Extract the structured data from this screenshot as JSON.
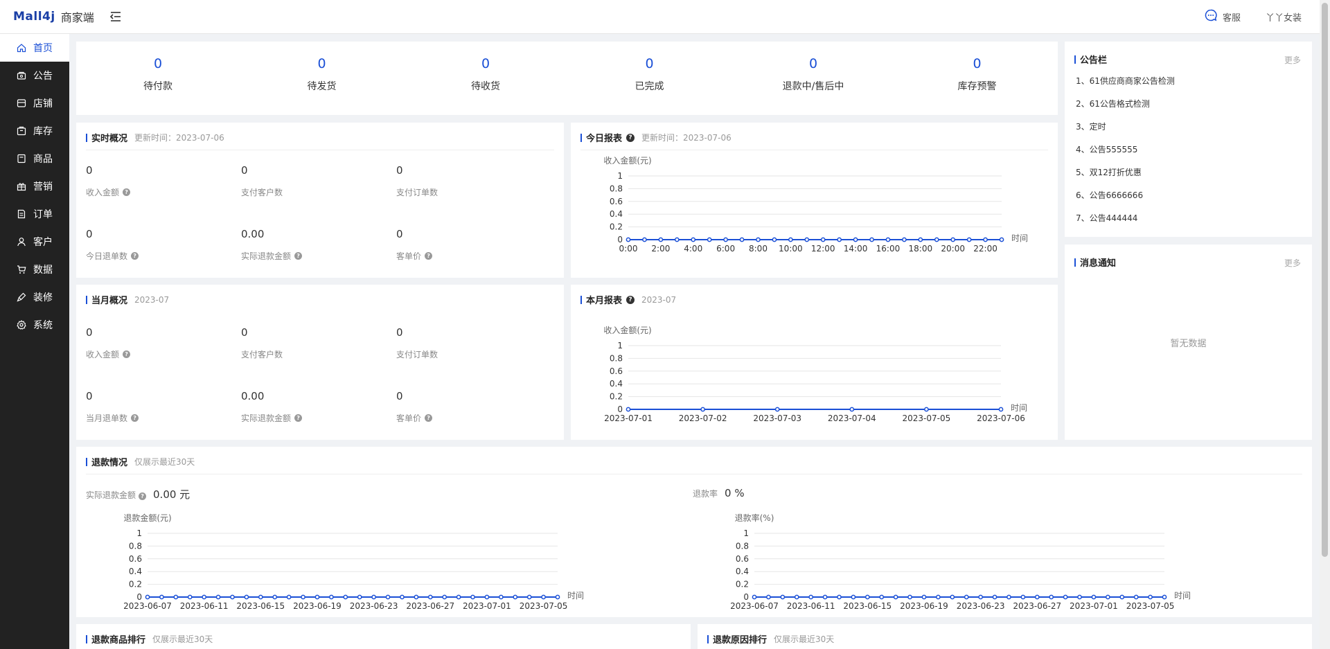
{
  "header": {
    "logo": "Mall4j",
    "logo_sub": "商家端",
    "customer_service": "客服",
    "user_name": "丫丫女装"
  },
  "sidebar": {
    "items": [
      {
        "label": "首页",
        "icon": "home-icon",
        "active": true
      },
      {
        "label": "公告",
        "icon": "announcement-icon"
      },
      {
        "label": "店铺",
        "icon": "store-icon"
      },
      {
        "label": "库存",
        "icon": "inventory-icon"
      },
      {
        "label": "商品",
        "icon": "product-icon"
      },
      {
        "label": "营销",
        "icon": "gift-icon"
      },
      {
        "label": "订单",
        "icon": "order-icon"
      },
      {
        "label": "客户",
        "icon": "user-icon"
      },
      {
        "label": "数据",
        "icon": "cart-icon"
      },
      {
        "label": "装修",
        "icon": "brush-icon"
      },
      {
        "label": "系统",
        "icon": "gear-icon"
      }
    ]
  },
  "stats": [
    {
      "value": "0",
      "label": "待付款"
    },
    {
      "value": "0",
      "label": "待发货"
    },
    {
      "value": "0",
      "label": "待收货"
    },
    {
      "value": "0",
      "label": "已完成"
    },
    {
      "value": "0",
      "label": "退款中/售后中"
    },
    {
      "value": "0",
      "label": "库存预警"
    }
  ],
  "realtime": {
    "title": "实时概况",
    "updated": "更新时间：2023-07-06",
    "metrics": [
      {
        "value": "0",
        "label": "收入金额",
        "help": true
      },
      {
        "value": "0",
        "label": "支付客户数",
        "help": false
      },
      {
        "value": "0",
        "label": "支付订单数",
        "help": false
      },
      {
        "value": "0",
        "label": "今日退单数",
        "help": true
      },
      {
        "value": "0.00",
        "label": "实际退款金额",
        "help": true
      },
      {
        "value": "0",
        "label": "客单价",
        "help": true
      }
    ]
  },
  "monthly": {
    "title": "当月概况",
    "period": "2023-07",
    "metrics": [
      {
        "value": "0",
        "label": "收入金额",
        "help": true
      },
      {
        "value": "0",
        "label": "支付客户数",
        "help": false
      },
      {
        "value": "0",
        "label": "支付订单数",
        "help": false
      },
      {
        "value": "0",
        "label": "当月退单数",
        "help": true
      },
      {
        "value": "0.00",
        "label": "实际退款金额",
        "help": true
      },
      {
        "value": "0",
        "label": "客单价",
        "help": true
      }
    ]
  },
  "today_report": {
    "title": "今日报表",
    "updated": "更新时间：2023-07-06"
  },
  "month_report": {
    "title": "本月报表",
    "period": "2023-07"
  },
  "notice_board": {
    "title": "公告栏",
    "more": "更多",
    "items": [
      "1、61供应商商家公告检测",
      "2、61公告格式检测",
      "3、定时",
      "4、公告555555",
      "5、双12打折优惠",
      "6、公告6666666",
      "7、公告444444"
    ]
  },
  "messages": {
    "title": "消息通知",
    "more": "更多",
    "empty": "暂无数据"
  },
  "refund": {
    "title": "退款情况",
    "note": "仅展示最近30天",
    "amount_label": "实际退款金额",
    "amount_value": "0.00 元",
    "rate_label": "退款率",
    "rate_value": "0 %"
  },
  "refund_goods": {
    "title": "退款商品排行",
    "note": "仅展示最近30天"
  },
  "refund_reason": {
    "title": "退款原因排行",
    "note": "仅展示最近30天"
  },
  "colors": {
    "accent": "#1a4fd6",
    "sidebar_bg": "#222222"
  },
  "chart_data": [
    {
      "id": "today",
      "type": "line",
      "ylabel": "收入金额(元)",
      "xlabel": "时间",
      "ylim": [
        0,
        1
      ],
      "y_ticks": [
        "0",
        "0.2",
        "0.4",
        "0.6",
        "0.8",
        "1"
      ],
      "x": [
        "0:00",
        "1:00",
        "2:00",
        "3:00",
        "4:00",
        "5:00",
        "6:00",
        "7:00",
        "8:00",
        "9:00",
        "10:00",
        "11:00",
        "12:00",
        "13:00",
        "14:00",
        "15:00",
        "16:00",
        "17:00",
        "18:00",
        "19:00",
        "20:00",
        "21:00",
        "22:00",
        "23:00"
      ],
      "x_tick_labels": [
        "0:00",
        "2:00",
        "4:00",
        "6:00",
        "8:00",
        "10:00",
        "12:00",
        "14:00",
        "16:00",
        "18:00",
        "20:00",
        "22:00"
      ],
      "series": [
        {
          "values": [
            0,
            0,
            0,
            0,
            0,
            0,
            0,
            0,
            0,
            0,
            0,
            0,
            0,
            0,
            0,
            0,
            0,
            0,
            0,
            0,
            0,
            0,
            0,
            0
          ]
        }
      ]
    },
    {
      "id": "month",
      "type": "line",
      "ylabel": "收入金额(元)",
      "xlabel": "时间",
      "ylim": [
        0,
        1
      ],
      "y_ticks": [
        "0",
        "0.2",
        "0.4",
        "0.6",
        "0.8",
        "1"
      ],
      "x": [
        "2023-07-01",
        "2023-07-02",
        "2023-07-03",
        "2023-07-04",
        "2023-07-05",
        "2023-07-06"
      ],
      "x_tick_labels": [
        "2023-07-01",
        "2023-07-02",
        "2023-07-03",
        "2023-07-04",
        "2023-07-05",
        "2023-07-06"
      ],
      "series": [
        {
          "values": [
            0,
            0,
            0,
            0,
            0,
            0
          ]
        }
      ]
    },
    {
      "id": "refund_amount",
      "type": "line",
      "ylabel": "退款金额(元)",
      "xlabel": "时间",
      "ylim": [
        0,
        1
      ],
      "y_ticks": [
        "0",
        "0.2",
        "0.4",
        "0.6",
        "0.8",
        "1"
      ],
      "x": [
        "2023-06-07",
        "2023-06-08",
        "2023-06-09",
        "2023-06-10",
        "2023-06-11",
        "2023-06-12",
        "2023-06-13",
        "2023-06-14",
        "2023-06-15",
        "2023-06-16",
        "2023-06-17",
        "2023-06-18",
        "2023-06-19",
        "2023-06-20",
        "2023-06-21",
        "2023-06-22",
        "2023-06-23",
        "2023-06-24",
        "2023-06-25",
        "2023-06-26",
        "2023-06-27",
        "2023-06-28",
        "2023-06-29",
        "2023-06-30",
        "2023-07-01",
        "2023-07-02",
        "2023-07-03",
        "2023-07-04",
        "2023-07-05",
        "2023-07-06"
      ],
      "x_tick_labels": [
        "2023-06-07",
        "2023-06-11",
        "2023-06-15",
        "2023-06-19",
        "2023-06-23",
        "2023-06-27",
        "2023-07-01",
        "2023-07-05"
      ],
      "series": [
        {
          "values": [
            0,
            0,
            0,
            0,
            0,
            0,
            0,
            0,
            0,
            0,
            0,
            0,
            0,
            0,
            0,
            0,
            0,
            0,
            0,
            0,
            0,
            0,
            0,
            0,
            0,
            0,
            0,
            0,
            0,
            0
          ]
        }
      ]
    },
    {
      "id": "refund_rate",
      "type": "line",
      "ylabel": "退款率(%)",
      "xlabel": "时间",
      "ylim": [
        0,
        1
      ],
      "y_ticks": [
        "0",
        "0.2",
        "0.4",
        "0.6",
        "0.8",
        "1"
      ],
      "x": [
        "2023-06-07",
        "2023-06-08",
        "2023-06-09",
        "2023-06-10",
        "2023-06-11",
        "2023-06-12",
        "2023-06-13",
        "2023-06-14",
        "2023-06-15",
        "2023-06-16",
        "2023-06-17",
        "2023-06-18",
        "2023-06-19",
        "2023-06-20",
        "2023-06-21",
        "2023-06-22",
        "2023-06-23",
        "2023-06-24",
        "2023-06-25",
        "2023-06-26",
        "2023-06-27",
        "2023-06-28",
        "2023-06-29",
        "2023-06-30",
        "2023-07-01",
        "2023-07-02",
        "2023-07-03",
        "2023-07-04",
        "2023-07-05",
        "2023-07-06"
      ],
      "x_tick_labels": [
        "2023-06-07",
        "2023-06-11",
        "2023-06-15",
        "2023-06-19",
        "2023-06-23",
        "2023-06-27",
        "2023-07-01",
        "2023-07-05"
      ],
      "series": [
        {
          "values": [
            0,
            0,
            0,
            0,
            0,
            0,
            0,
            0,
            0,
            0,
            0,
            0,
            0,
            0,
            0,
            0,
            0,
            0,
            0,
            0,
            0,
            0,
            0,
            0,
            0,
            0,
            0,
            0,
            0,
            0
          ]
        }
      ]
    }
  ]
}
